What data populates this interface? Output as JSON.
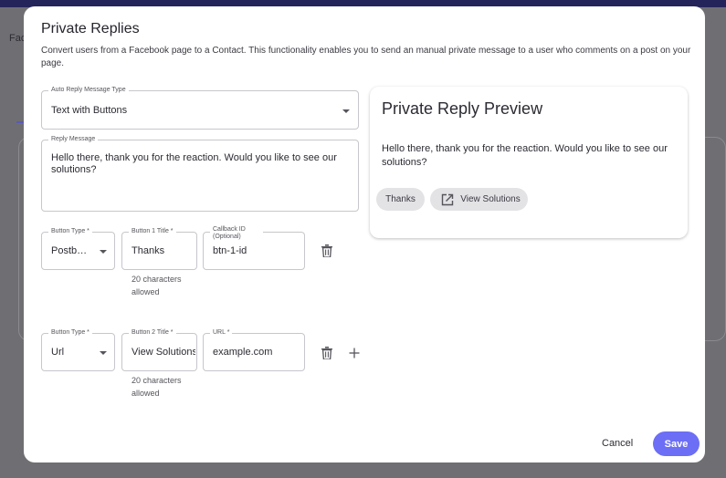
{
  "background": {
    "partial_text": "Fac"
  },
  "modal": {
    "title": "Private Replies",
    "description": "Convert users from a Facebook page to a Contact. This functionality enables you to send an manual private message to a user who comments on a post on your page."
  },
  "form": {
    "auto_reply_type": {
      "label": "Auto Reply Message Type",
      "value": "Text with Buttons"
    },
    "reply_message": {
      "label": "Reply Message",
      "value": "Hello there, thank you for the reaction. Would you like to see our solutions?"
    },
    "rows": [
      {
        "type_label": "Button Type *",
        "type_value": "Postback",
        "title_label": "Button 1 Title *",
        "title_value": "Thanks",
        "extra_label": "Callback ID (Optional)",
        "extra_value": "btn-1-id",
        "helper": "20 characters allowed"
      },
      {
        "type_label": "Button Type *",
        "type_value": "Url",
        "title_label": "Button 2 Title *",
        "title_value": "View Solutions",
        "extra_label": "URL *",
        "extra_value": "example.com",
        "helper": "20 characters allowed"
      }
    ]
  },
  "preview": {
    "title": "Private Reply Preview",
    "message": "Hello there, thank you for the reaction. Would you like to see our solutions?",
    "chips": [
      {
        "label": "Thanks",
        "icon": "none"
      },
      {
        "label": "View Solutions",
        "icon": "open-in-new-icon"
      }
    ]
  },
  "actions": {
    "cancel": "Cancel",
    "save": "Save"
  },
  "colors": {
    "primary": "#6c6ef5",
    "topbar": "#25245a"
  }
}
